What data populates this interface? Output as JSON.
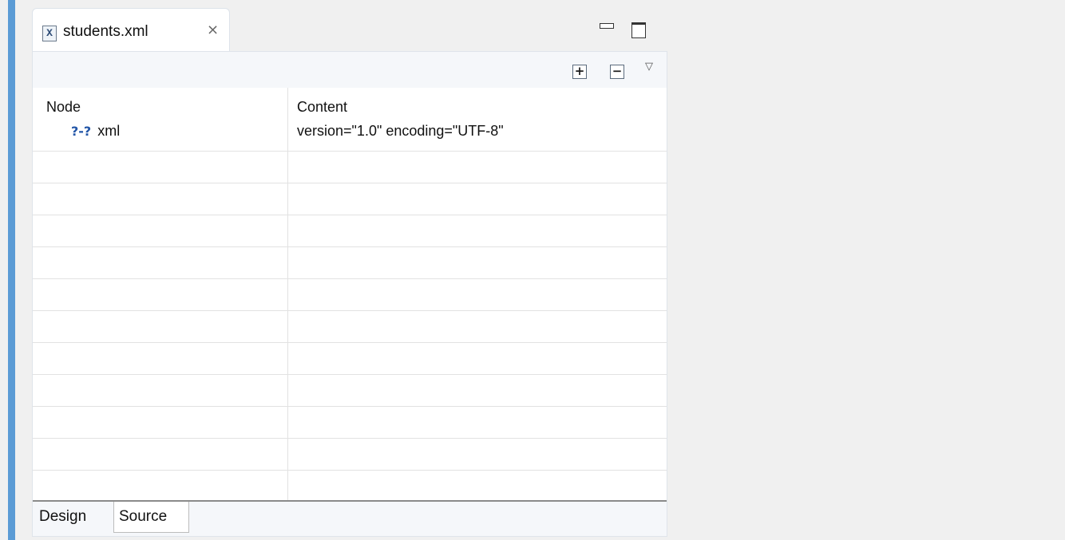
{
  "editor": {
    "tab": {
      "icon": "xml-file-icon",
      "icon_glyph": "X",
      "title": "students.xml",
      "close_glyph": "⨯"
    },
    "window_controls": {
      "minimize": "minimize-icon",
      "maximize": "maximize-icon"
    },
    "toolbar": {
      "expand_glyph": "+",
      "collapse_glyph": "−",
      "menu_glyph": "▽"
    },
    "grid": {
      "columns": [
        "Node",
        "Content"
      ],
      "rows": [
        {
          "icon_text": "?-?",
          "node": "xml",
          "content": "version=\"1.0\" encoding=\"UTF-8\""
        }
      ]
    },
    "bottom_tabs": [
      "Design",
      "Source"
    ]
  },
  "colors": {
    "accent": "#5b9bd5",
    "node_icon": "#2457a8"
  }
}
